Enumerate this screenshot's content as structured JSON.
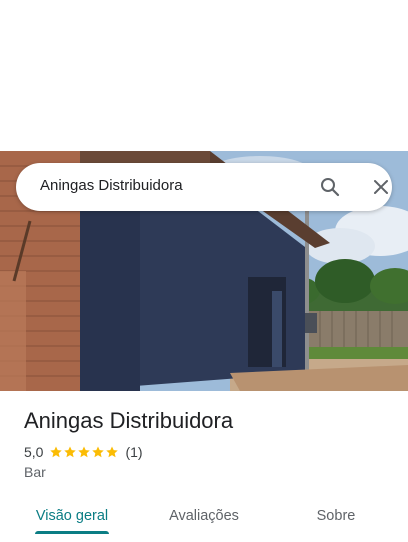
{
  "search": {
    "query": "Aningas Distribuidora"
  },
  "icons": {
    "search": "search-icon",
    "close": "close-icon",
    "star": "star-icon"
  },
  "colors": {
    "accent": "#0b7d84",
    "star": "#fbbc04",
    "wall": "#2e3a57",
    "brick": "#a8674a"
  },
  "place": {
    "title": "Aningas Distribuidora",
    "rating": "5,0",
    "stars": 5,
    "review_count": "(1)",
    "category": "Bar"
  },
  "tabs": [
    {
      "label": "Visão geral",
      "active": true
    },
    {
      "label": "Avaliações",
      "active": false
    },
    {
      "label": "Sobre",
      "active": false
    }
  ]
}
